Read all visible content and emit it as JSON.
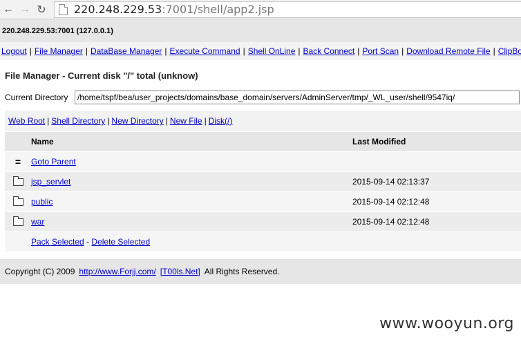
{
  "browser": {
    "url_host": "220.248.229.53",
    "url_rest": ":7001/shell/app2.jsp"
  },
  "server": {
    "label": "220.248.229.53:7001 (127.0.0.1)"
  },
  "toplinks": [
    "Logout",
    "File Manager",
    "DataBase Manager",
    "Execute Command",
    "Shell OnLine",
    "Back Connect",
    "Port Scan",
    "Download Remote File",
    "ClipBo"
  ],
  "main": {
    "title": "File Manager - Current disk \"/\" total (unknow)",
    "current_dir_label": "Current Directory",
    "current_dir_value": "/home/tspf/bea/user_projects/domains/base_domain/servers/AdminServer/tmp/_WL_user/shell/9547iq/",
    "quick_links": [
      "Web Root",
      "Shell Directory",
      "New Directory",
      "New File",
      "Disk(/)"
    ],
    "columns": {
      "name": "Name",
      "modified": "Last Modified"
    },
    "goto_parent": {
      "icon": "=",
      "label": "Goto Parent"
    },
    "rows": [
      {
        "name": "jsp_servlet",
        "modified": "2015-09-14 02:13:37"
      },
      {
        "name": "public",
        "modified": "2015-09-14 02:12:48"
      },
      {
        "name": "war",
        "modified": "2015-09-14 02:12:48"
      }
    ],
    "actions": {
      "pack": "Pack Selected",
      "sep": "-",
      "delete": "Delete Selected"
    }
  },
  "footer": {
    "copyright": "Copyright (C) 2009",
    "link1": "http://www.Forjj.com/",
    "link2": "[T00ls.Net]",
    "rights": "All Rights Reserved."
  },
  "watermark": "www.wooyun.org",
  "icons": [
    "back-arrow-icon",
    "forward-arrow-icon",
    "reload-icon",
    "page-icon",
    "folder-icon"
  ]
}
